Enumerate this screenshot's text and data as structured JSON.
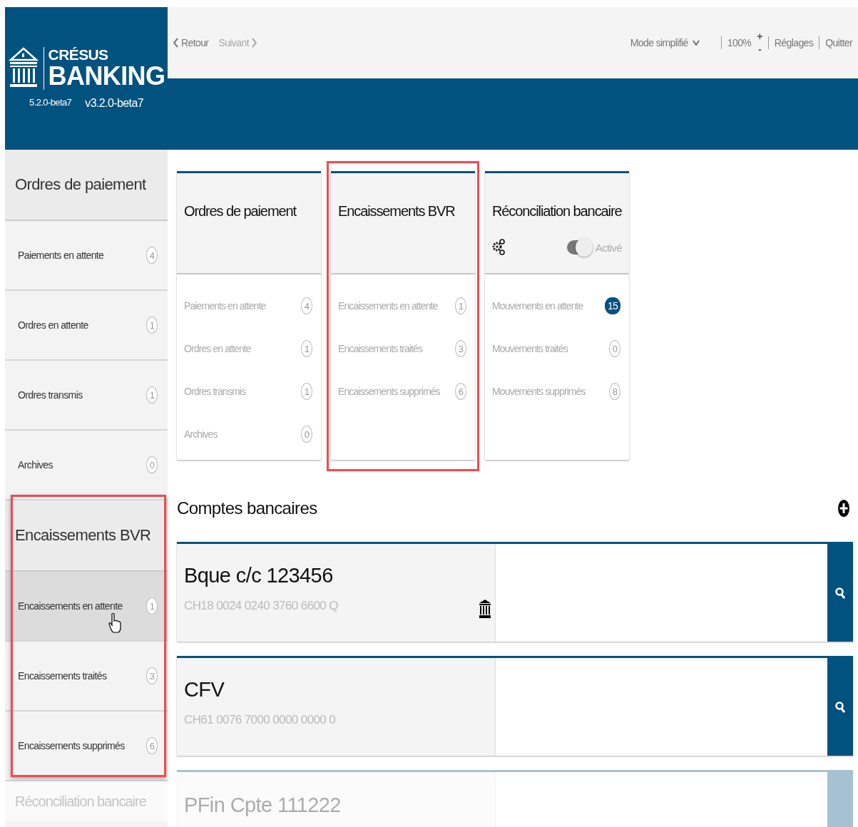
{
  "app": {
    "name_top": "CRÉSUS",
    "name_bottom": "BANKING",
    "version_left": "5.2.0-beta7",
    "version_right": "v3.2.0-beta7"
  },
  "toolbar": {
    "back": {
      "label": "Retour",
      "disabled": false
    },
    "forward": {
      "label": "Suivant",
      "disabled": true
    },
    "mode": "Mode simplifié",
    "zoom": "100%",
    "zoom_in": "+",
    "zoom_out": "-",
    "links": [
      "Réglages",
      "Quitter"
    ]
  },
  "sidebar": {
    "sections": [
      {
        "title": "Ordres de paiement",
        "highlighted": false,
        "faded": false,
        "items": [
          {
            "label": "Paiements en attente",
            "count": "4",
            "selected": false
          },
          {
            "label": "Ordres en attente",
            "count": "1",
            "selected": false
          },
          {
            "label": "Ordres transmis",
            "count": "1",
            "selected": false
          },
          {
            "label": "Archives",
            "count": "0",
            "selected": false
          }
        ]
      },
      {
        "title": "Encaissements BVR",
        "highlighted": true,
        "faded": false,
        "items": [
          {
            "label": "Encaissements en attente",
            "count": "1",
            "selected": true
          },
          {
            "label": "Encaissements traités",
            "count": "3",
            "selected": false
          },
          {
            "label": "Encaissements supprimés",
            "count": "6",
            "selected": false
          }
        ]
      },
      {
        "title": "Réconciliation bancaire",
        "highlighted": false,
        "faded": true
      }
    ]
  },
  "cards": [
    {
      "title": "Ordres de paiement",
      "highlighted": false,
      "items": [
        {
          "label": "Paiements en attente",
          "count": "4",
          "emphasized": false
        },
        {
          "label": "Ordres en attente",
          "count": "1",
          "emphasized": false
        },
        {
          "label": "Ordres transmis",
          "count": "1",
          "emphasized": false
        },
        {
          "label": "Archives",
          "count": "0",
          "emphasized": false
        }
      ]
    },
    {
      "title": "Encaissements BVR",
      "highlighted": true,
      "items": [
        {
          "label": "Encaissements en attente",
          "count": "1",
          "emphasized": false
        },
        {
          "label": "Encaissements traités",
          "count": "3",
          "emphasized": false
        },
        {
          "label": "Encaissements supprimés",
          "count": "6",
          "emphasized": false
        }
      ]
    },
    {
      "title": "Réconciliation bancaire",
      "highlighted": false,
      "toggle": {
        "label": "Activé",
        "on": true
      },
      "items": [
        {
          "label": "Mouvements en attente",
          "count": "15",
          "emphasized": true
        },
        {
          "label": "Mouvements traités",
          "count": "0",
          "emphasized": false
        },
        {
          "label": "Mouvements supprimés",
          "count": "8",
          "emphasized": false
        }
      ]
    }
  ],
  "accounts": {
    "title": "Comptes bancaires",
    "items": [
      {
        "name": "Bque c/c 123456",
        "iban": "CH18 0024 0240 3760 6600 Q",
        "bank_icon": true,
        "faded": false
      },
      {
        "name": "CFV",
        "iban": "CH61 0076 7000 0000 0000 0",
        "bank_icon": false,
        "faded": false
      },
      {
        "name": "PFin Cpte 111222",
        "bank_icon": false,
        "faded": true
      }
    ]
  }
}
